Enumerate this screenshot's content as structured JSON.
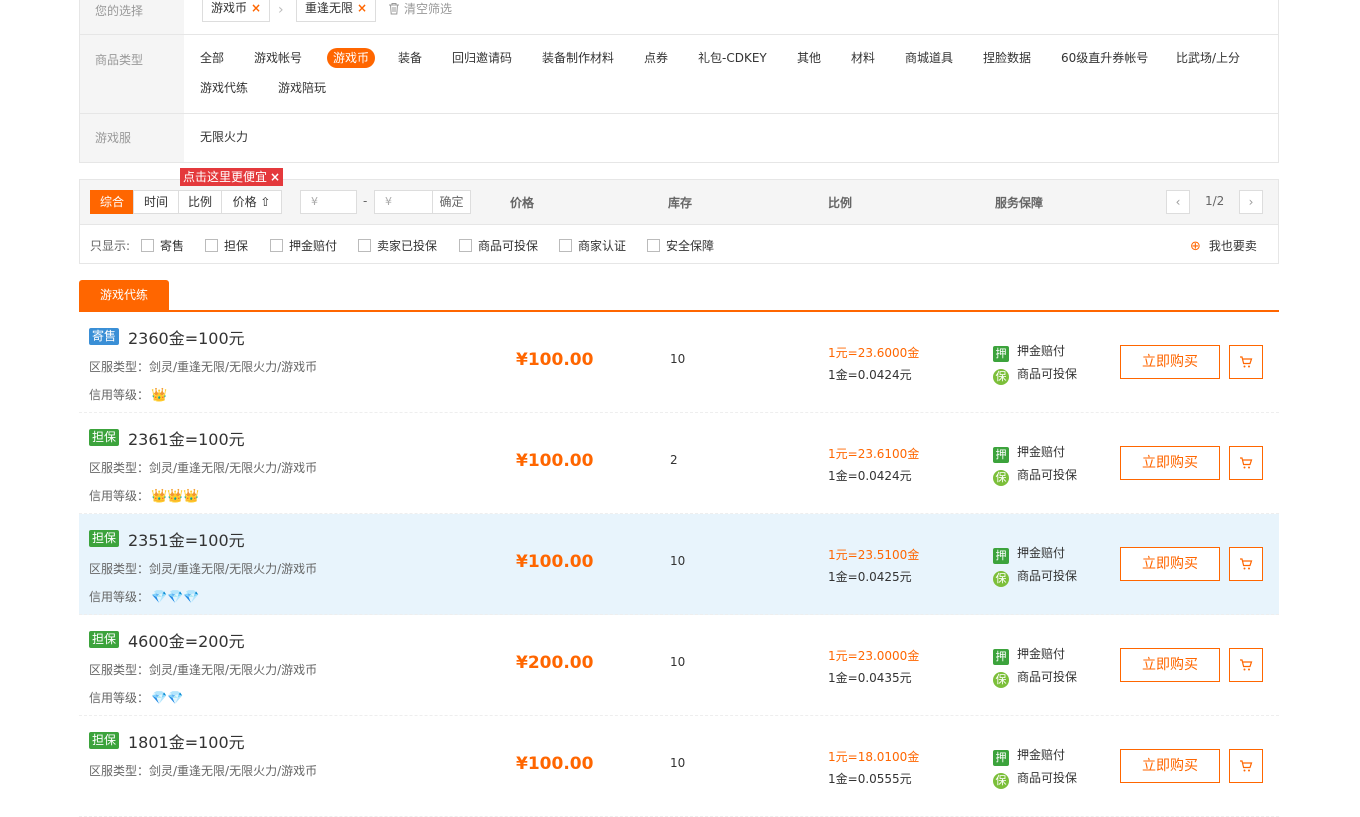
{
  "filters": {
    "selection_label": "您的选择",
    "chips": [
      {
        "label": "游戏币",
        "remove": "×"
      },
      {
        "label": "重逢无限",
        "remove": "×"
      }
    ],
    "breadcrumb_sep": "›",
    "clear_label": "清空筛选",
    "category_label": "商品类型",
    "categories": [
      {
        "label": "全部",
        "active": false
      },
      {
        "label": "游戏帐号",
        "active": false
      },
      {
        "label": "游戏币",
        "active": true
      },
      {
        "label": "装备",
        "active": false
      },
      {
        "label": "回归邀请码",
        "active": false
      },
      {
        "label": "装备制作材料",
        "active": false
      },
      {
        "label": "点券",
        "active": false
      },
      {
        "label": "礼包-CDKEY",
        "active": false
      },
      {
        "label": "其他",
        "active": false
      },
      {
        "label": "材料",
        "active": false
      },
      {
        "label": "商城道具",
        "active": false
      },
      {
        "label": "捏脸数据",
        "active": false
      },
      {
        "label": "60级直升券帐号",
        "active": false
      },
      {
        "label": "比武场/上分",
        "active": false
      },
      {
        "label": "游戏代练",
        "active": false
      },
      {
        "label": "游戏陪玩",
        "active": false
      }
    ],
    "server_label": "游戏服",
    "server_value": "无限火力"
  },
  "sortbar": {
    "sorts": [
      {
        "label": "综合",
        "active": true
      },
      {
        "label": "时间",
        "active": false
      },
      {
        "label": "比例",
        "active": false
      },
      {
        "label": "价格 ⇧",
        "active": false
      }
    ],
    "tip": "点击这里更便宜",
    "tip_close": "×",
    "price_min_placeholder": "¥",
    "price_dash": "-",
    "price_max_placeholder": "¥",
    "confirm_label": "确定",
    "columns": [
      "价格",
      "库存",
      "比例",
      "服务保障"
    ],
    "pager": {
      "prev": "‹",
      "page": "1/2",
      "next": "›"
    },
    "show_only_label": "只显示:",
    "checkboxes": [
      "寄售",
      "担保",
      "押金赔付",
      "卖家已投保",
      "商品可投保",
      "商家认证",
      "安全保障"
    ],
    "sell_label": "我也要卖",
    "sell_icon": "⊕"
  },
  "tab": {
    "label": "游戏代练"
  },
  "listings": [
    {
      "badge": "寄售",
      "badge_color": "#3a8fd6",
      "title": "2360金=100元",
      "region": "区服类型：剑灵/重逢无限/无限火力/游戏币",
      "credit_label": "信用等级：",
      "credit_icons": "👑",
      "price": "¥100.00",
      "stock": "10",
      "ratio1": "1元=23.6000金",
      "ratio2": "1金=0.0424元",
      "svc1_icon": "押",
      "svc1": "押金赔付",
      "svc2_icon": "保",
      "svc2": "商品可投保",
      "buy": "立即购买",
      "highlight": false
    },
    {
      "badge": "担保",
      "badge_color": "#3ca33c",
      "title": "2361金=100元",
      "region": "区服类型：剑灵/重逢无限/无限火力/游戏币",
      "credit_label": "信用等级：",
      "credit_icons": "👑👑👑",
      "price": "¥100.00",
      "stock": "2",
      "ratio1": "1元=23.6100金",
      "ratio2": "1金=0.0424元",
      "svc1_icon": "押",
      "svc1": "押金赔付",
      "svc2_icon": "保",
      "svc2": "商品可投保",
      "buy": "立即购买",
      "highlight": false
    },
    {
      "badge": "担保",
      "badge_color": "#3ca33c",
      "title": "2351金=100元",
      "region": "区服类型：剑灵/重逢无限/无限火力/游戏币",
      "credit_label": "信用等级：",
      "credit_icons": "💎💎💎",
      "price": "¥100.00",
      "stock": "10",
      "ratio1": "1元=23.5100金",
      "ratio2": "1金=0.0425元",
      "svc1_icon": "押",
      "svc1": "押金赔付",
      "svc2_icon": "保",
      "svc2": "商品可投保",
      "buy": "立即购买",
      "highlight": true
    },
    {
      "badge": "担保",
      "badge_color": "#3ca33c",
      "title": "4600金=200元",
      "region": "区服类型：剑灵/重逢无限/无限火力/游戏币",
      "credit_label": "信用等级：",
      "credit_icons": "💎💎",
      "price": "¥200.00",
      "stock": "10",
      "ratio1": "1元=23.0000金",
      "ratio2": "1金=0.0435元",
      "svc1_icon": "押",
      "svc1": "押金赔付",
      "svc2_icon": "保",
      "svc2": "商品可投保",
      "buy": "立即购买",
      "highlight": false
    },
    {
      "badge": "担保",
      "badge_color": "#3ca33c",
      "title": "1801金=100元",
      "region": "区服类型：剑灵/重逢无限/无限火力/游戏币",
      "credit_label": "",
      "credit_icons": "",
      "price": "¥100.00",
      "stock": "10",
      "ratio1": "1元=18.0100金",
      "ratio2": "1金=0.0555元",
      "svc1_icon": "押",
      "svc1": "押金赔付",
      "svc2_icon": "保",
      "svc2": "商品可投保",
      "buy": "立即购买",
      "highlight": false
    }
  ]
}
